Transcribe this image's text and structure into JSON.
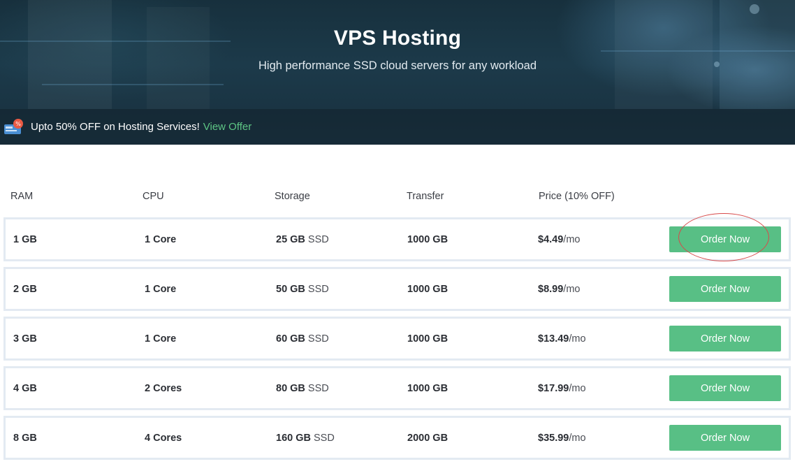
{
  "hero": {
    "title": "VPS Hosting",
    "subtitle": "High performance SSD cloud servers for any workload"
  },
  "offer": {
    "icon": "sale-tag-icon",
    "text": "Upto 50% OFF on Hosting Services!",
    "link": "View Offer"
  },
  "table": {
    "headers": [
      "RAM",
      "CPU",
      "Storage",
      "Transfer",
      "Price (10% OFF)"
    ],
    "rows": [
      {
        "ram": "1 GB",
        "cpu": "1 Core",
        "storage": "25 GB",
        "storage_type": "SSD",
        "transfer": "1000 GB",
        "price": "$4.49",
        "period": "/mo",
        "button": "Order Now"
      },
      {
        "ram": "2 GB",
        "cpu": "1 Core",
        "storage": "50 GB",
        "storage_type": "SSD",
        "transfer": "1000 GB",
        "price": "$8.99",
        "period": "/mo",
        "button": "Order Now"
      },
      {
        "ram": "3 GB",
        "cpu": "1 Core",
        "storage": "60 GB",
        "storage_type": "SSD",
        "transfer": "1000 GB",
        "price": "$13.49",
        "period": "/mo",
        "button": "Order Now"
      },
      {
        "ram": "4 GB",
        "cpu": "2 Cores",
        "storage": "80 GB",
        "storage_type": "SSD",
        "transfer": "1000 GB",
        "price": "$17.99",
        "period": "/mo",
        "button": "Order Now"
      },
      {
        "ram": "8 GB",
        "cpu": "4 Cores",
        "storage": "160 GB",
        "storage_type": "SSD",
        "transfer": "2000 GB",
        "price": "$35.99",
        "period": "/mo",
        "button": "Order Now"
      }
    ]
  },
  "colors": {
    "accent": "#58bf85",
    "hero_bg": "#1c3a4a",
    "row_border": "#e3eaf2",
    "highlight": "#d84a4a"
  }
}
